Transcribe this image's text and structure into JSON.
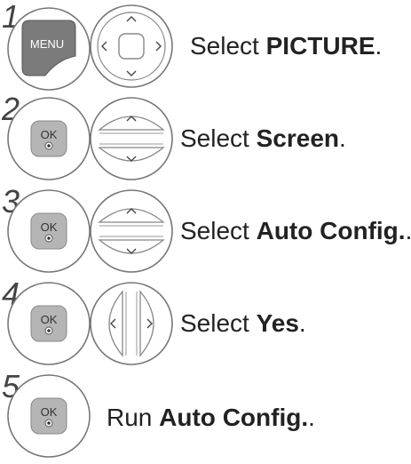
{
  "steps": [
    {
      "number": "1",
      "left_button": "MENU",
      "nav": "dpad",
      "prefix": "Select ",
      "bold": "PICTURE",
      "suffix": "."
    },
    {
      "number": "2",
      "left_button": "OK",
      "nav": "updown",
      "prefix": "Select ",
      "bold": "Screen",
      "suffix": "."
    },
    {
      "number": "3",
      "left_button": "OK",
      "nav": "updown",
      "prefix": "Select ",
      "bold": "Auto Config.",
      "suffix": "."
    },
    {
      "number": "4",
      "left_button": "OK",
      "nav": "leftright",
      "prefix": "Select ",
      "bold": "Yes",
      "suffix": "."
    },
    {
      "number": "5",
      "left_button": "OK",
      "nav": "none",
      "prefix": "Run ",
      "bold": "Auto Config.",
      "suffix": "."
    }
  ],
  "icons": {
    "menu_button": "menu-button-icon",
    "ok_button": "ok-button-icon",
    "dpad": "dpad-icon",
    "updown": "up-down-buttons-icon",
    "leftright": "left-right-buttons-icon"
  },
  "colors": {
    "button_fill": "#b5b5b5",
    "button_dark": "#8a8a8a",
    "outline": "#777777",
    "text": "#222222"
  }
}
